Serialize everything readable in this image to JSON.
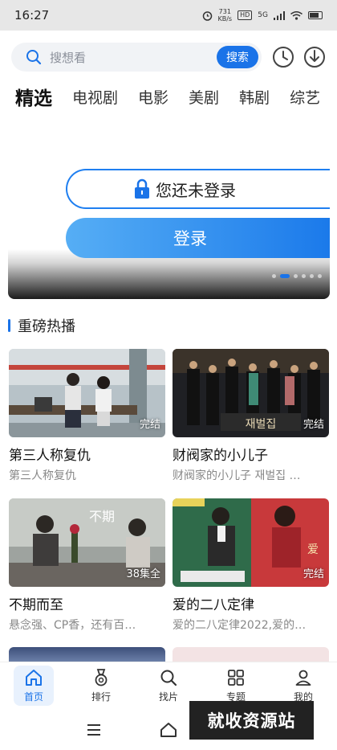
{
  "status_bar": {
    "time": "16:27",
    "net_speed_value": "731",
    "net_speed_unit": "KB/s",
    "hd_label": "HD",
    "signal_label": "5G"
  },
  "search": {
    "placeholder": "搜想看",
    "button_label": "搜索"
  },
  "tabs": [
    "精选",
    "电视剧",
    "电影",
    "美剧",
    "韩剧",
    "综艺"
  ],
  "banner": {
    "login_status": "您还未登录",
    "login_button": "登录",
    "active_dot": 1,
    "dot_count": 6
  },
  "section": {
    "title": "重磅热播"
  },
  "cards": [
    {
      "title": "第三人称复仇",
      "subtitle": "第三人称复仇",
      "badge": "完结"
    },
    {
      "title": "财阀家的小儿子",
      "subtitle": "财阀家的小儿子 재벌집 …",
      "badge": "完结"
    },
    {
      "title": "不期而至",
      "subtitle": "悬念强、CP香，还有百…",
      "badge": "38集全"
    },
    {
      "title": "爱的二八定律",
      "subtitle": "爱的二八定律2022,爱的…",
      "badge": "完结"
    }
  ],
  "bottom_nav": [
    {
      "label": "首页",
      "icon": "home-icon",
      "active": true
    },
    {
      "label": "排行",
      "icon": "medal-icon",
      "active": false
    },
    {
      "label": "找片",
      "icon": "search-icon",
      "active": false
    },
    {
      "label": "专题",
      "icon": "grid-icon",
      "active": false
    },
    {
      "label": "我的",
      "icon": "user-icon",
      "active": false
    }
  ],
  "watermark": "就收资源站",
  "colors": {
    "accent": "#1a73e8",
    "status_bar_bg": "#e7e7e7",
    "subtitle_gray": "#888888"
  }
}
